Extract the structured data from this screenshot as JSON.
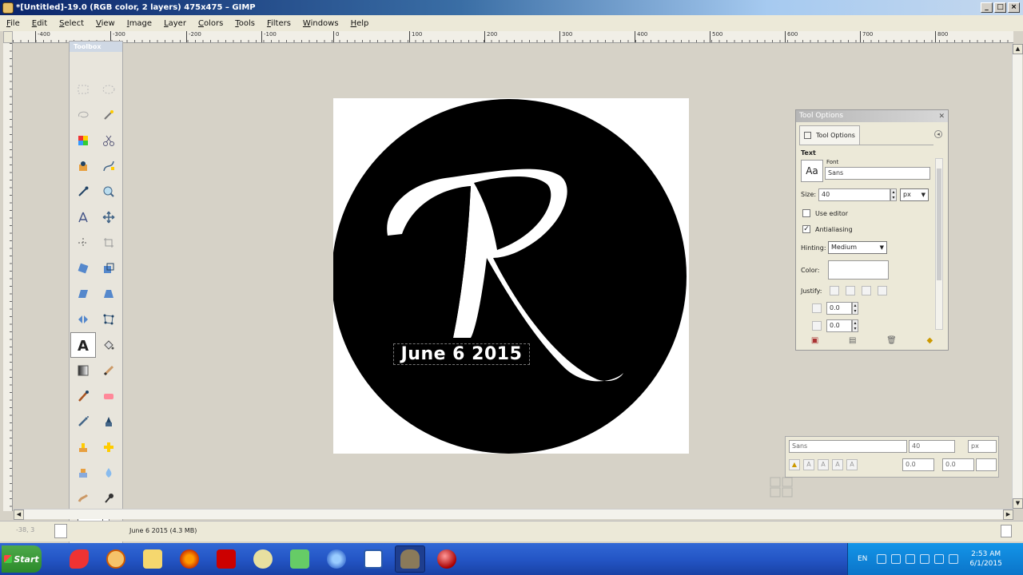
{
  "window": {
    "title": "*[Untitled]-19.0 (RGB color, 2 layers) 475x475 – GIMP",
    "min": "_",
    "max": "□",
    "close": "×"
  },
  "menu": [
    "File",
    "Edit",
    "Select",
    "View",
    "Image",
    "Layer",
    "Colors",
    "Tools",
    "Filters",
    "Windows",
    "Help"
  ],
  "ruler": [
    "-400",
    "-300",
    "-200",
    "-100",
    "0",
    "100",
    "200",
    "300",
    "400",
    "500",
    "600",
    "700",
    "800"
  ],
  "toolbox": {
    "title": "Toolbox"
  },
  "image": {
    "text_layer": "June 6 2015",
    "logo_letter": "R"
  },
  "tool_options": {
    "title": "Tool Options",
    "tab_label": "Tool Options",
    "section": "Text",
    "font_label": "Font",
    "font_value": "Sans",
    "font_btn": "Aa",
    "size_label": "Size:",
    "size_value": "40",
    "unit": "px",
    "use_editor": "Use editor",
    "antialiasing": "Antialiasing",
    "hinting_label": "Hinting:",
    "hinting_value": "Medium",
    "color_label": "Color:",
    "justify_label": "Justify:",
    "indent_value": "0.0",
    "line_spacing_value": "0.0",
    "check": "✓"
  },
  "text_editor": {
    "font": "Sans",
    "size": "40",
    "unit": "px",
    "baseline": "0.0",
    "kerning": "0.0"
  },
  "status": {
    "coords": "-38, 3",
    "message": "June 6 2015 (4.3 MB)"
  },
  "taskbar": {
    "start": "Start",
    "lang": "EN",
    "time": "2:53 AM",
    "date": "6/1/2015"
  },
  "colors": {
    "titlebar": "#0a246a",
    "taskbar": "#2456c6",
    "logo": "#000000",
    "canvas_bg": "#d6d2c7"
  }
}
